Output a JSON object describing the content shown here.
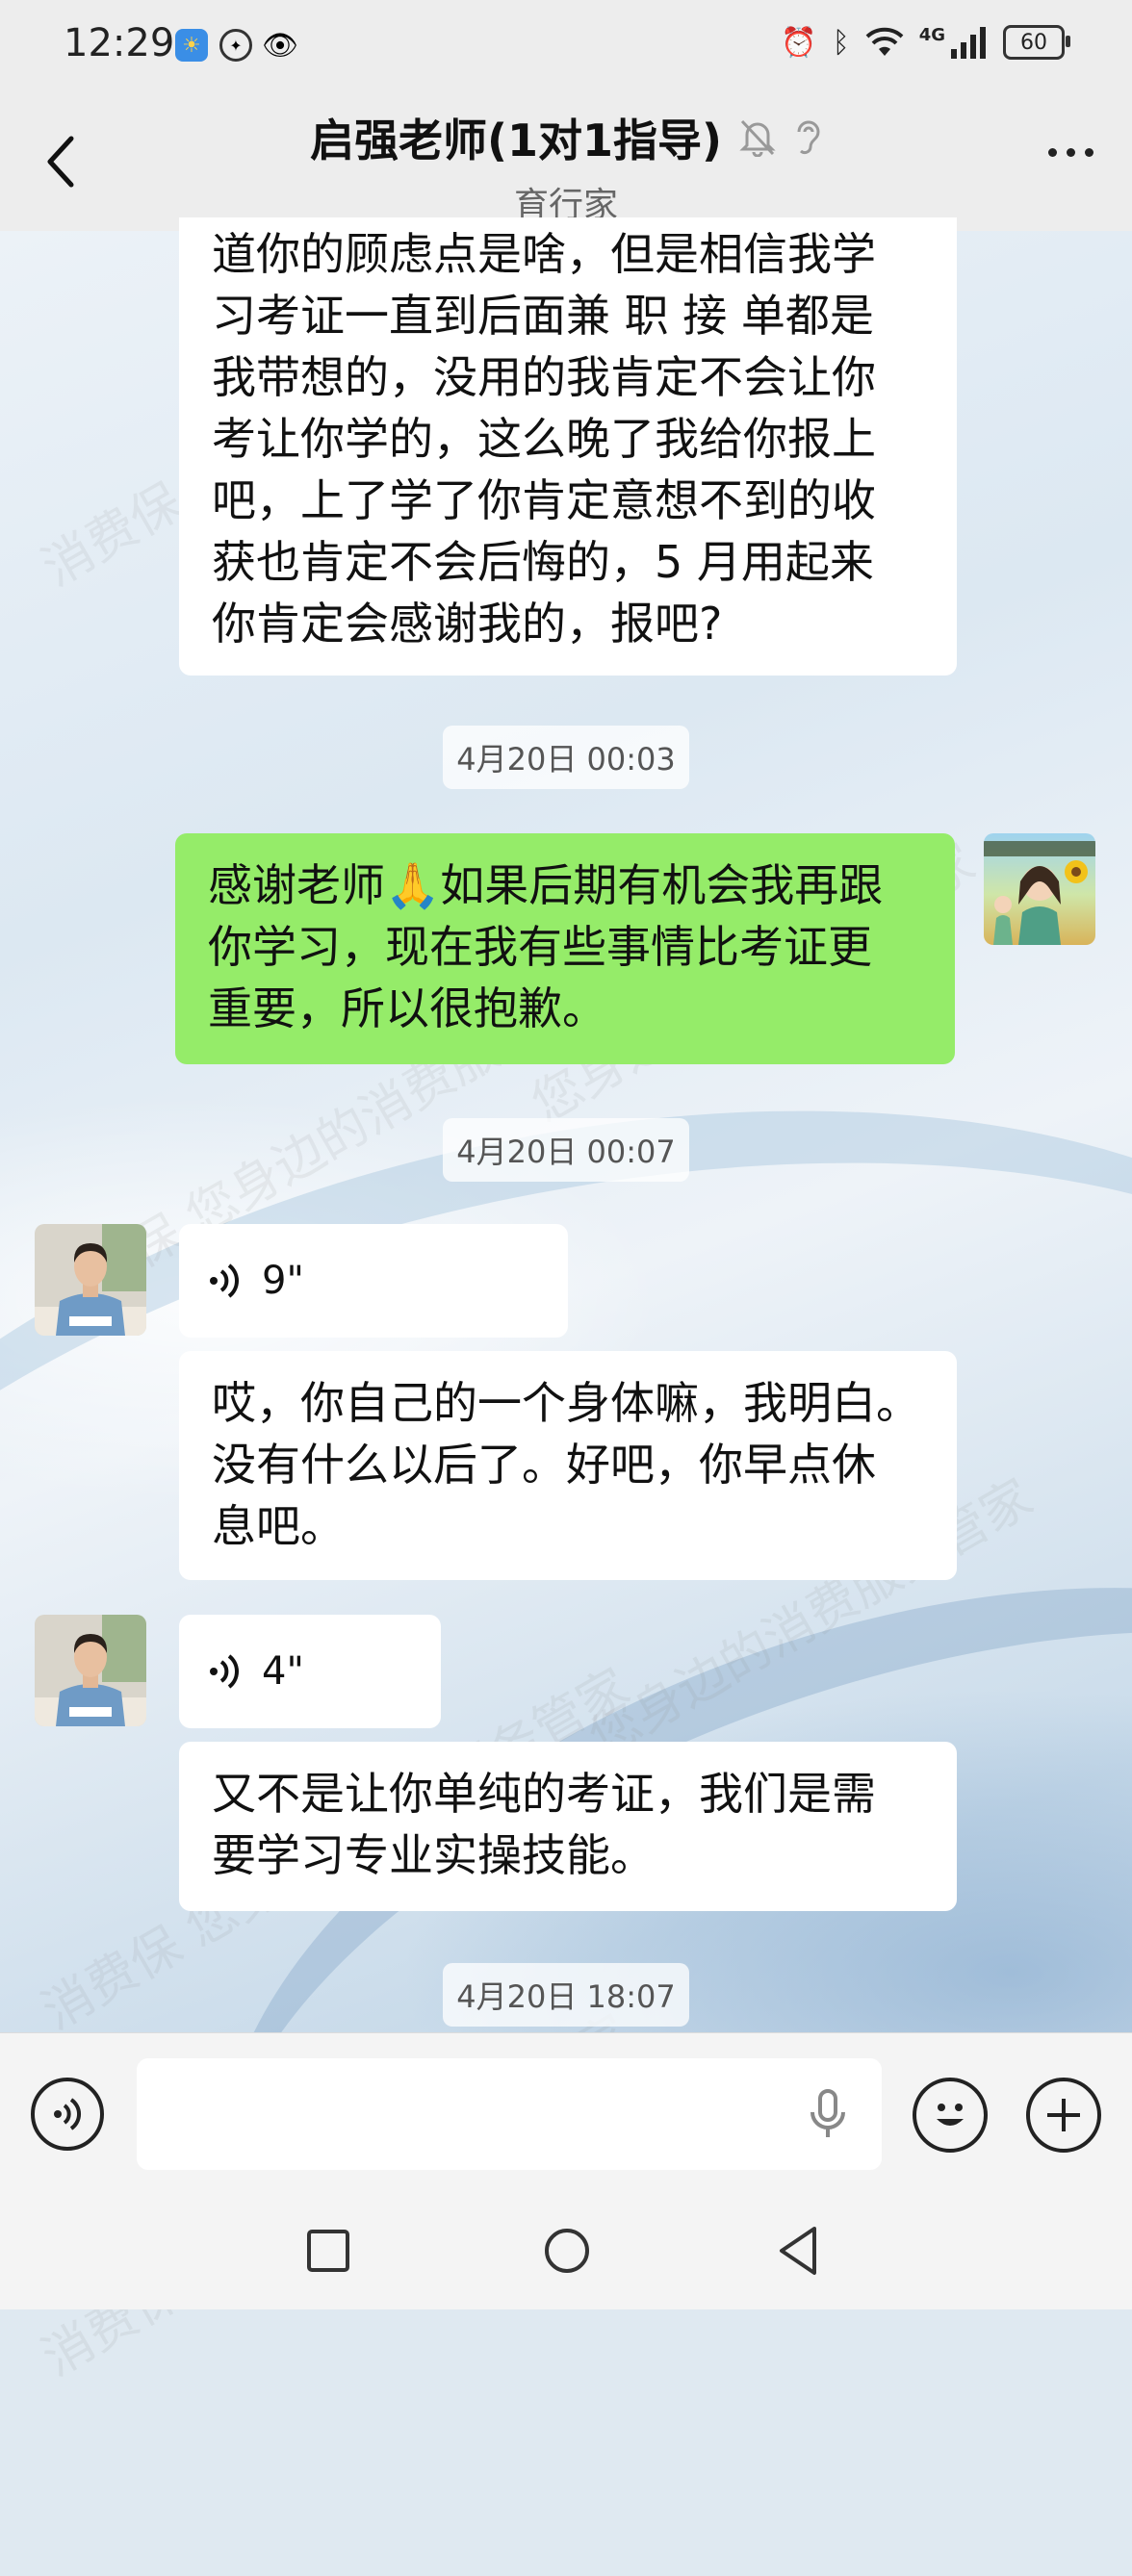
{
  "status_bar": {
    "time": "12:29",
    "signal": "4G",
    "battery": "60"
  },
  "header": {
    "title": "启强老师(1对1指导)",
    "subtitle": "育行家"
  },
  "messages": {
    "m1": "道你的顾虑点是啥，但是相信我学\n习考证一直到后面兼 职 接 单都是\n我带想的，没用的我肯定不会让你\n考让你学的，这么晚了我给你报上\n吧，上了学了你肯定意想不到的收\n获也肯定不会后悔的，5 月用起来\n你肯定会感谢我的，报吧?",
    "ts1": "4月20日 00:03",
    "m2": "感谢老师🙏如果后期有机会我再跟\n你学习，现在我有些事情比考证更\n重要，所以很抱歉。",
    "ts2": "4月20日 00:07",
    "voice1": "9\"",
    "m3": "哎，你自己的一个身体嘛，我明白。\n没有什么以后了。好吧，你早点休\n息吧。",
    "voice2": "4\"",
    "m4": "又不是让你单纯的考证，我们是需\n要学习专业实操技能。",
    "ts3": "4月20日 18:07"
  },
  "input": {
    "value": ""
  },
  "icons": {
    "back": "chevron-left-icon",
    "mute": "bell-off-icon",
    "ear": "ear-icon",
    "more": "more-dots-icon",
    "voice_toggle": "voice-input-icon",
    "mic": "microphone-icon",
    "emoji": "smiley-icon",
    "plus": "plus-icon"
  },
  "colors": {
    "my_bubble": "#95ec69",
    "their_bubble": "#ffffff",
    "bar_bg": "#ededed"
  }
}
